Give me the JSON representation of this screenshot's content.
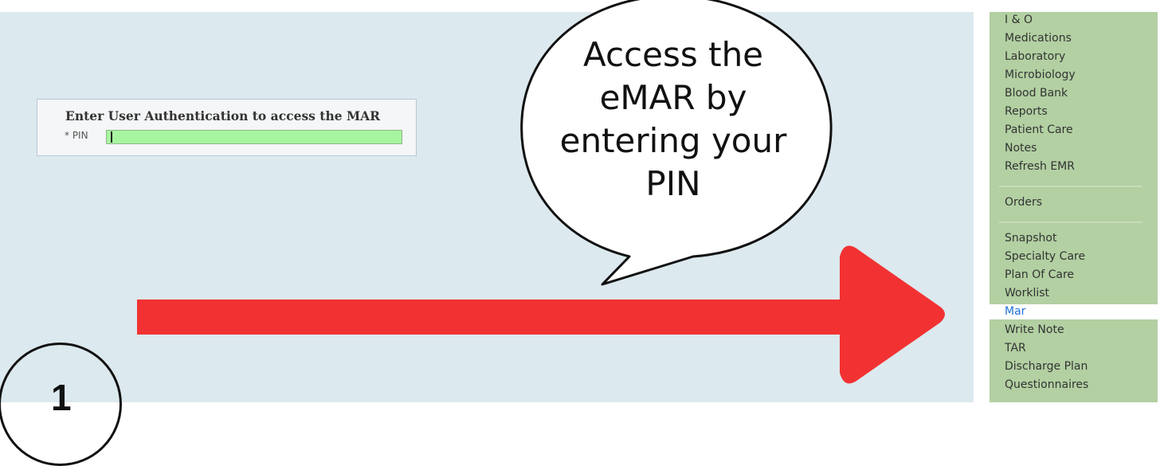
{
  "auth_panel": {
    "title": "Enter User Authentication to access the MAR",
    "pin_label": "* PIN",
    "pin_value": ""
  },
  "callout": {
    "lines": [
      "Access the",
      "eMAR by",
      "entering your",
      "PIN"
    ]
  },
  "step_badge": {
    "number": "1"
  },
  "sidebar": {
    "group1": [
      "I & O",
      "Medications",
      "Laboratory",
      "Microbiology",
      "Blood Bank",
      "Reports",
      "Patient Care",
      "Notes",
      "Refresh EMR"
    ],
    "group2": [
      "Orders"
    ],
    "group3": [
      "Snapshot",
      "Specialty Care",
      "Plan Of Care",
      "Worklist",
      "Mar",
      "Write Note",
      "TAR",
      "Discharge Plan",
      "Questionnaires"
    ],
    "selected": "Mar"
  },
  "colors": {
    "arrow": "#f23232",
    "sidebar_bg": "#b2d0a2",
    "selected_item_text": "#1f6fd6",
    "pin_field": "#a8f5a0",
    "main_bg": "#dce9ee"
  }
}
